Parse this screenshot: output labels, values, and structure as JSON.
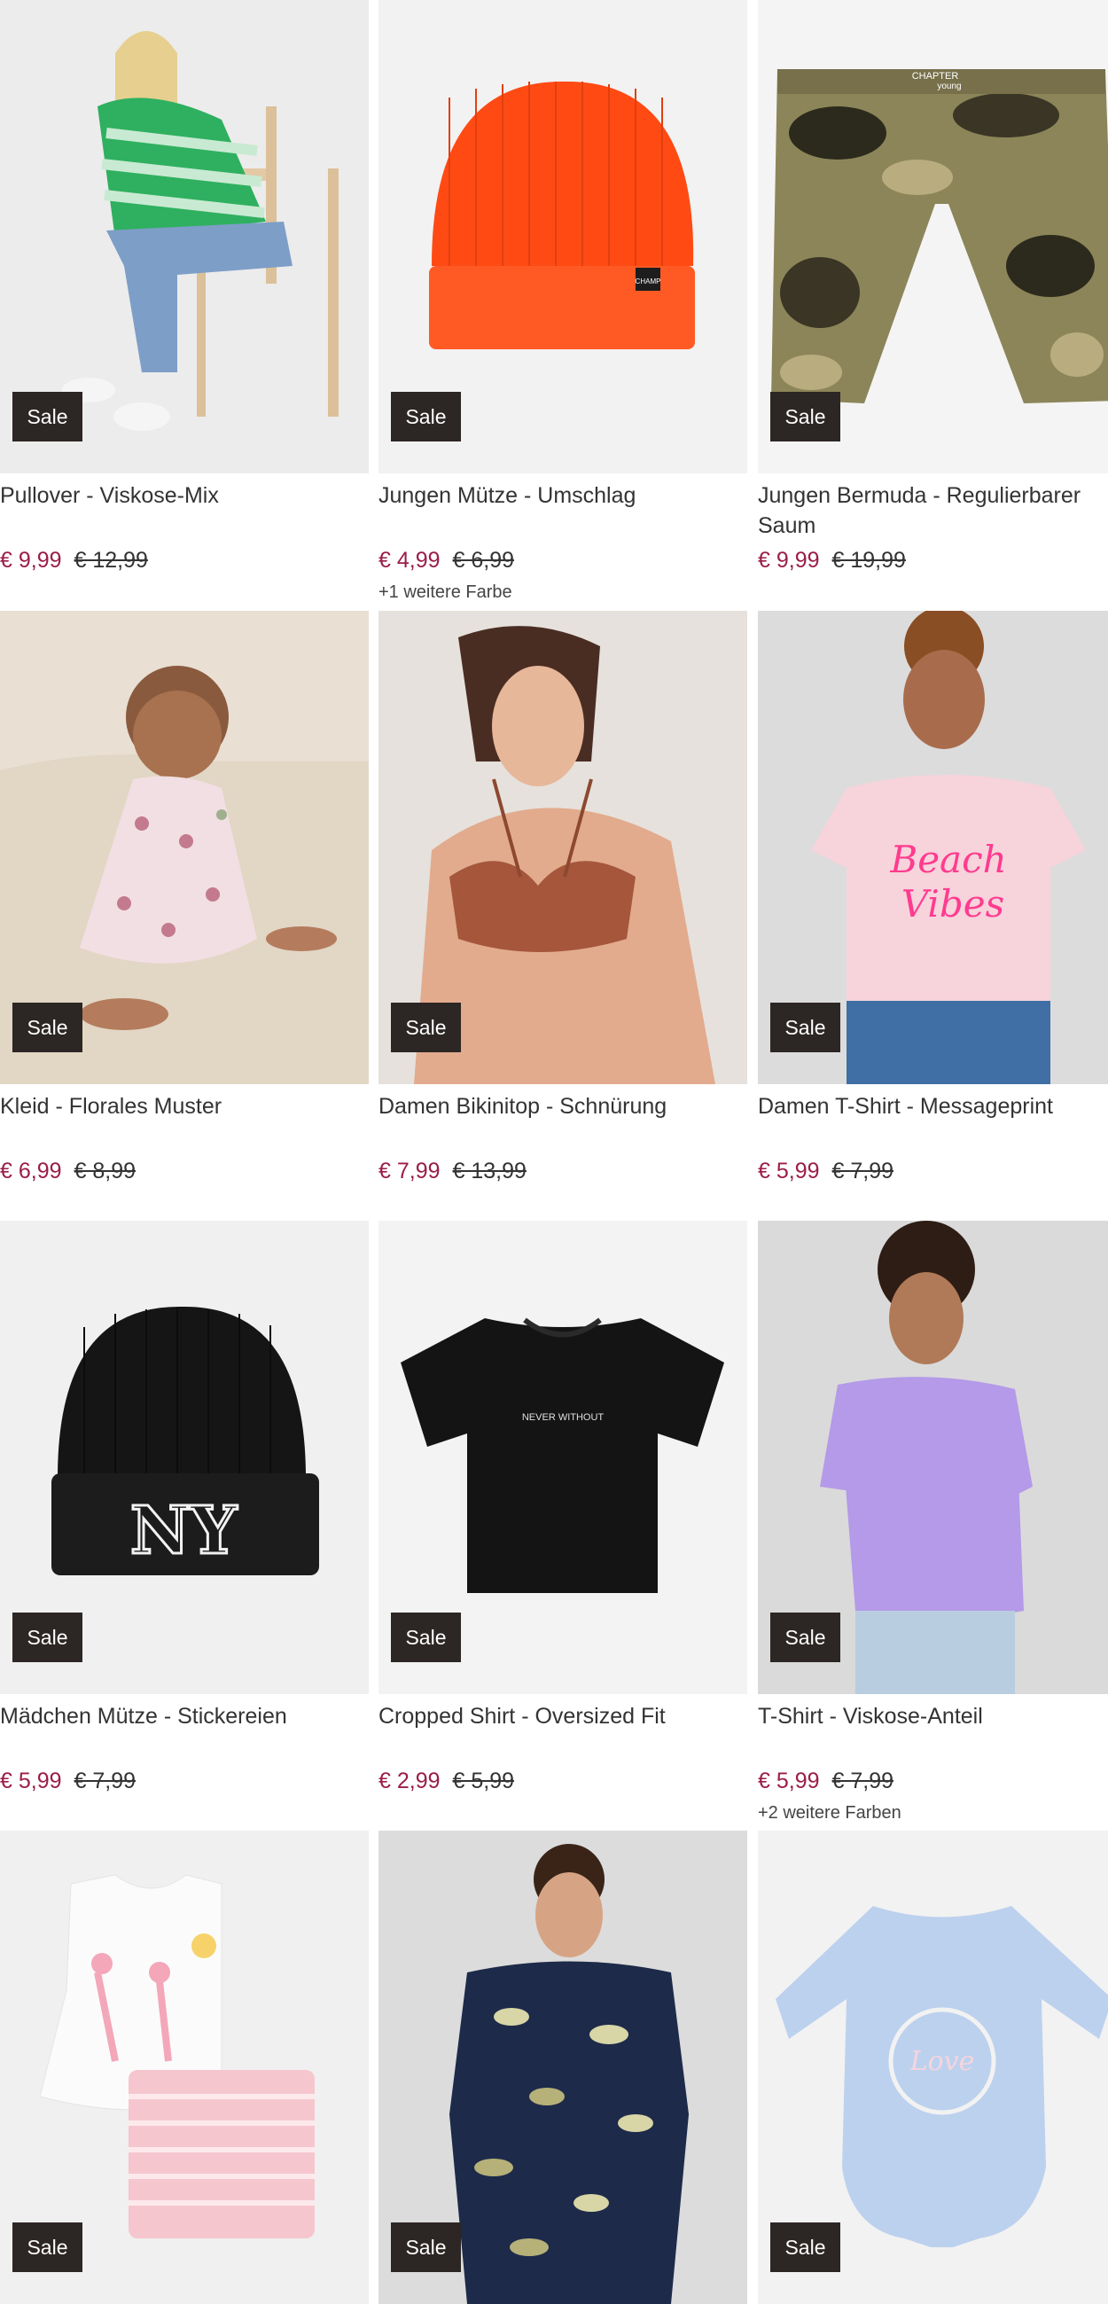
{
  "products": [
    {
      "title": "Pullover - Viskose-Mix",
      "badge": "Sale",
      "price": "€ 9,99",
      "old_price": "€ 12,99",
      "more": "",
      "image": "woman-green-striped-pullover"
    },
    {
      "title": "Jungen Mütze - Umschlag",
      "badge": "Sale",
      "price": "€ 4,99",
      "old_price": "€ 6,99",
      "more": "+1 weitere Farbe",
      "image": "orange-beanie"
    },
    {
      "title": "Jungen Bermuda - Regulierbarer Saum",
      "badge": "Sale",
      "price": "€ 9,99",
      "old_price": "€ 19,99",
      "more": "",
      "image": "camo-bermuda-shorts"
    },
    {
      "title": "Kleid - Florales Muster",
      "badge": "Sale",
      "price": "€ 6,99",
      "old_price": "€ 8,99",
      "more": "",
      "image": "baby-floral-dress"
    },
    {
      "title": "Damen Bikinitop - Schnürung",
      "badge": "Sale",
      "price": "€ 7,99",
      "old_price": "€ 13,99",
      "more": "",
      "image": "brown-bikini-top"
    },
    {
      "title": "Damen T-Shirt - Messageprint",
      "badge": "Sale",
      "price": "€ 5,99",
      "old_price": "€ 7,99",
      "more": "",
      "image": "pink-tshirt-beach-vibes"
    },
    {
      "title": "Mädchen Mütze - Stickereien",
      "badge": "Sale",
      "price": "€ 5,99",
      "old_price": "€ 7,99",
      "more": "",
      "image": "black-ny-beanie"
    },
    {
      "title": "Cropped Shirt - Oversized Fit",
      "badge": "Sale",
      "price": "€ 2,99",
      "old_price": "€ 5,99",
      "more": "",
      "image": "black-cropped-shirt"
    },
    {
      "title": "T-Shirt - Viskose-Anteil",
      "badge": "Sale",
      "price": "€ 5,99",
      "old_price": "€ 7,99",
      "more": "+2 weitere Farben",
      "image": "lilac-tshirt"
    },
    {
      "title": "",
      "badge": "Sale",
      "price": "",
      "old_price": "",
      "more": "",
      "image": "flamingo-baby-set"
    },
    {
      "title": "",
      "badge": "Sale",
      "price": "",
      "old_price": "",
      "more": "",
      "image": "man-leaf-print-shirt"
    },
    {
      "title": "",
      "badge": "Sale",
      "price": "",
      "old_price": "",
      "more": "",
      "image": "blue-baby-bodysuit"
    }
  ],
  "image_texts": {
    "beanie_label": "CHAMP",
    "shorts_brand": "CHAPTER",
    "shorts_sub": "young",
    "tshirt_print_1": "Beach",
    "tshirt_print_2": "Vibes",
    "beanie_ny": "NY",
    "crop_print": "NEVER WITHOUT",
    "body_print": "Love"
  },
  "colors": {
    "price_sale": "#9b1d4a",
    "badge_bg": "#2c2624",
    "image_bg": "#f0f0f0"
  }
}
